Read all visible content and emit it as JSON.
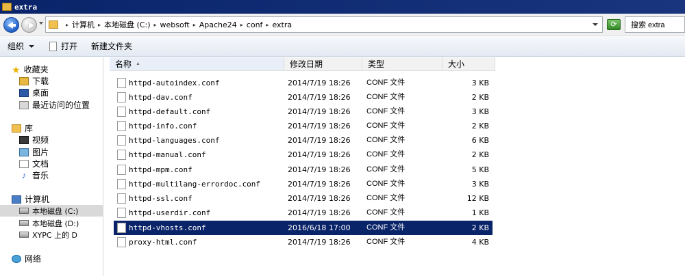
{
  "window": {
    "title": "extra"
  },
  "address": {
    "crumbs": [
      "计算机",
      "本地磁盘 (C:)",
      "websoft",
      "Apache24",
      "conf",
      "extra"
    ]
  },
  "search": {
    "text": "搜索 extra"
  },
  "toolbar": {
    "organize": "组织",
    "open": "打开",
    "new_folder": "新建文件夹"
  },
  "nav": {
    "favorites": "收藏夹",
    "downloads": "下载",
    "desktop": "桌面",
    "recent": "最近访问的位置",
    "libraries": "库",
    "videos": "视频",
    "pictures": "图片",
    "documents": "文档",
    "music": "音乐",
    "computer": "计算机",
    "disk_c": "本地磁盘 (C:)",
    "disk_d": "本地磁盘 (D:)",
    "xypc": "XYPC 上的 D",
    "network": "网络"
  },
  "columns": {
    "name": "名称",
    "modified": "修改日期",
    "type": "类型",
    "size": "大小"
  },
  "files": [
    {
      "name": "httpd-autoindex.conf",
      "modified": "2014/7/19 18:26",
      "type": "CONF 文件",
      "size": "3 KB"
    },
    {
      "name": "httpd-dav.conf",
      "modified": "2014/7/19 18:26",
      "type": "CONF 文件",
      "size": "2 KB"
    },
    {
      "name": "httpd-default.conf",
      "modified": "2014/7/19 18:26",
      "type": "CONF 文件",
      "size": "3 KB"
    },
    {
      "name": "httpd-info.conf",
      "modified": "2014/7/19 18:26",
      "type": "CONF 文件",
      "size": "2 KB"
    },
    {
      "name": "httpd-languages.conf",
      "modified": "2014/7/19 18:26",
      "type": "CONF 文件",
      "size": "6 KB"
    },
    {
      "name": "httpd-manual.conf",
      "modified": "2014/7/19 18:26",
      "type": "CONF 文件",
      "size": "2 KB"
    },
    {
      "name": "httpd-mpm.conf",
      "modified": "2014/7/19 18:26",
      "type": "CONF 文件",
      "size": "5 KB"
    },
    {
      "name": "httpd-multilang-errordoc.conf",
      "modified": "2014/7/19 18:26",
      "type": "CONF 文件",
      "size": "3 KB"
    },
    {
      "name": "httpd-ssl.conf",
      "modified": "2014/7/19 18:26",
      "type": "CONF 文件",
      "size": "12 KB"
    },
    {
      "name": "httpd-userdir.conf",
      "modified": "2014/7/19 18:26",
      "type": "CONF 文件",
      "size": "1 KB"
    },
    {
      "name": "httpd-vhosts.conf",
      "modified": "2016/6/18 17:00",
      "type": "CONF 文件",
      "size": "2 KB",
      "selected": true
    },
    {
      "name": "proxy-html.conf",
      "modified": "2014/7/19 18:26",
      "type": "CONF 文件",
      "size": "4 KB"
    }
  ],
  "colors": {
    "titlebar": "#0a246a",
    "selection": "#0a246a"
  }
}
